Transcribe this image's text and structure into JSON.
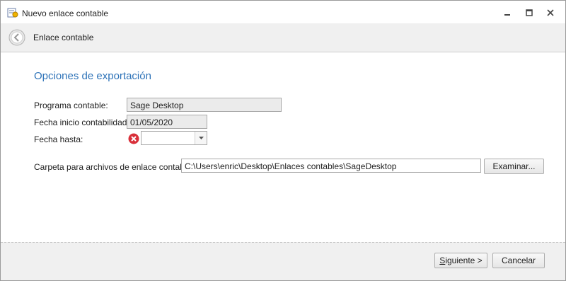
{
  "window": {
    "title": "Nuevo enlace contable",
    "icon": "ledger-app-icon",
    "controls": [
      "minimize-icon",
      "maximize-icon",
      "close-icon"
    ]
  },
  "header": {
    "back_icon": "back-arrow-icon",
    "title": "Enlace contable"
  },
  "form": {
    "section_title": "Opciones de exportación",
    "programa_label": "Programa contable:",
    "programa_value": "Sage Desktop",
    "fecha_inicio_label": "Fecha inicio contabilidad:",
    "fecha_inicio_value": "01/05/2020",
    "fecha_hasta_label": "Fecha hasta:",
    "fecha_hasta_value": "",
    "fecha_hasta_error_icon": "error-x-icon",
    "carpeta_label": "Carpeta para archivos de enlace contable:",
    "carpeta_value": "C:\\Users\\enric\\Desktop\\Enlaces contables\\SageDesktop",
    "examinar_label": "Examinar..."
  },
  "footer": {
    "siguiente_first": "S",
    "siguiente_rest": "iguiente >",
    "cancelar_label": "Cancelar"
  },
  "colors": {
    "accent": "#2e73b8",
    "header_bg": "#f0f0f0",
    "readonly_bg": "#ebebeb",
    "error": "#d9303a"
  }
}
